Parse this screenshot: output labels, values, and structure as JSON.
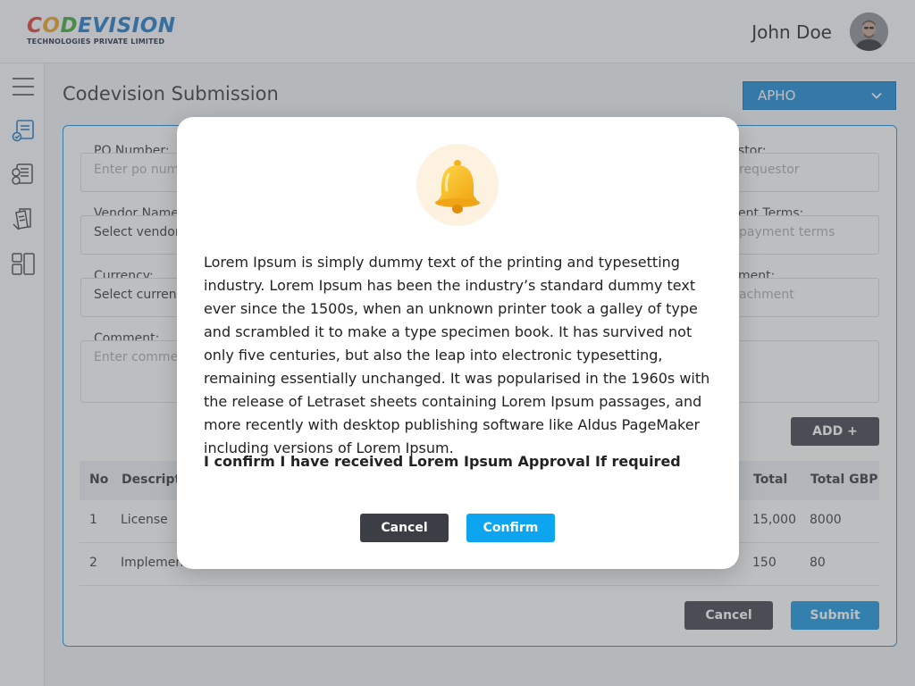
{
  "header": {
    "logo": {
      "text_parts": [
        "C",
        "O",
        "D",
        "EVISION"
      ],
      "subtitle": "TECHNOLOGIES PRIVATE LIMITED"
    },
    "user_name": "John Doe"
  },
  "sidebar": {
    "items": [
      {
        "name": "menu-icon"
      },
      {
        "name": "submission-icon",
        "active": true
      },
      {
        "name": "approvals-icon"
      },
      {
        "name": "documents-icon"
      },
      {
        "name": "layout-icon"
      }
    ]
  },
  "page": {
    "title": "Codevision Submission",
    "entity_select": {
      "value": "APHO"
    }
  },
  "form": {
    "po_number": {
      "label": "PO Number:",
      "placeholder": "Enter po numb"
    },
    "vendor_name": {
      "label": "Vendor Name:",
      "value": "Select vendor"
    },
    "currency": {
      "label": "Currency:",
      "value": "Select currenc"
    },
    "comment": {
      "label": "Comment:",
      "placeholder": "Enter commen"
    },
    "requestor": {
      "label": "stor:",
      "placeholder": "requestor"
    },
    "payment_terms": {
      "label": "ent Terms:",
      "placeholder": "payment terms"
    },
    "attachment": {
      "label": "ment:",
      "placeholder": "achment"
    },
    "add_label": "ADD +"
  },
  "table": {
    "headers": {
      "no": "No",
      "description": "Descripti",
      "total": "Total",
      "total_gbp": "Total GBP"
    },
    "rows": [
      {
        "no": "1",
        "description": "License",
        "total": "15,000",
        "total_gbp": "8000"
      },
      {
        "no": "2",
        "description": "Implementation",
        "total": "150",
        "total_gbp": "80"
      }
    ]
  },
  "footer_actions": {
    "cancel_label": "Cancel",
    "submit_label": "Submit"
  },
  "modal": {
    "icon": "bell-icon",
    "body": "Lorem Ipsum is simply dummy text of the printing and typesetting industry. Lorem Ipsum has been the industry’s standard dummy text ever since the 1500s, when an unknown printer took a galley of type and scrambled it to make a type specimen book. It has survived not only five centuries, but also the leap into electronic typesetting, remaining essentially unchanged. It was popularised in the 1960s with the release of Letraset sheets containing Lorem Ipsum passages, and more recently with desktop publishing software like Aldus PageMaker including versions of Lorem Ipsum.",
    "confirm_text": "I confirm I have received Lorem Ipsum Approval If required",
    "cancel_label": "Cancel",
    "confirm_label": "Confirm"
  },
  "colors": {
    "primary": "#1493e0",
    "dark_button": "#3b3f45",
    "confirm": "#0ea5f0"
  }
}
